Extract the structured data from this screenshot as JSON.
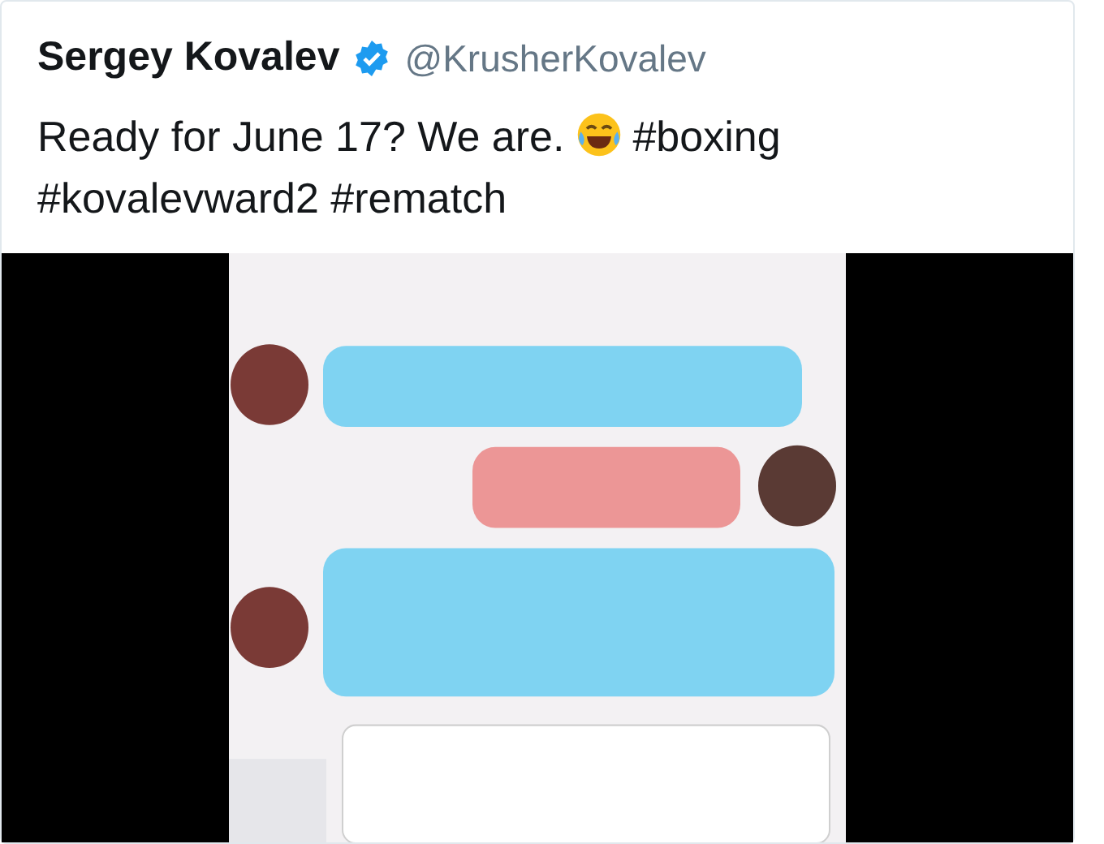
{
  "tweet": {
    "name": "Sergey Kovalev",
    "verified": true,
    "handle": "@KrusherKovalev",
    "text_before": "Ready for June 17? We are.",
    "text_after": "#boxing",
    "text_line2": "#kovalevward2 #rematch"
  }
}
